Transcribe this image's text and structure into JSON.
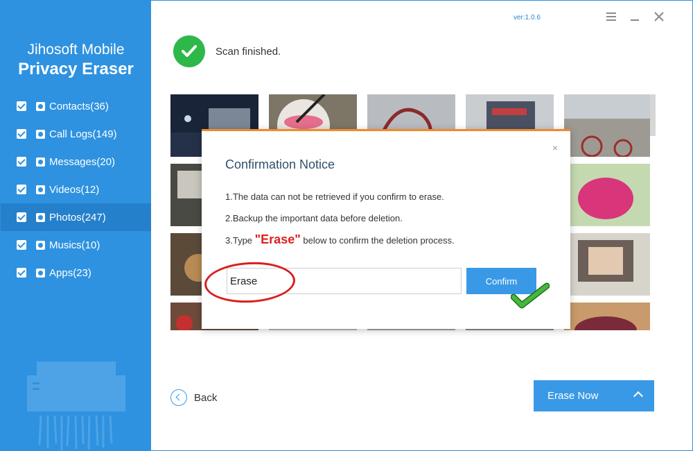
{
  "app": {
    "brand_line1": "Jihosoft Mobile",
    "brand_line2": "Privacy Eraser",
    "version": "ver:1.0.6"
  },
  "sidebar": {
    "items": [
      {
        "label": "Contacts(36)",
        "icon": "contacts-icon",
        "checked": true
      },
      {
        "label": "Call Logs(149)",
        "icon": "phone-icon",
        "checked": true
      },
      {
        "label": "Messages(20)",
        "icon": "message-icon",
        "checked": true
      },
      {
        "label": "Videos(12)",
        "icon": "video-icon",
        "checked": true
      },
      {
        "label": "Photos(247)",
        "icon": "photo-icon",
        "checked": true,
        "active": true
      },
      {
        "label": "Musics(10)",
        "icon": "music-icon",
        "checked": true
      },
      {
        "label": "Apps(23)",
        "icon": "apps-icon",
        "checked": true
      }
    ]
  },
  "status": {
    "text": "Scan finished."
  },
  "dialog": {
    "title": "Confirmation Notice",
    "close": "×",
    "line1": "1.The data can not be retrieved if you confirm to erase.",
    "line2": "2.Backup the important data before deletion.",
    "line3_prefix": "3.Type ",
    "line3_keyword": "\"Erase\"",
    "line3_suffix": " below to confirm the deletion process.",
    "input_value": "Erase",
    "confirm_label": "Confirm"
  },
  "footer": {
    "back_label": "Back",
    "erase_now_label": "Erase Now"
  },
  "colors": {
    "sidebar": "#2e92e0",
    "accent": "#3a99e6",
    "success": "#2fb84a",
    "dialog_border": "#ef8a2c",
    "highlight_red": "#d81f1f"
  }
}
